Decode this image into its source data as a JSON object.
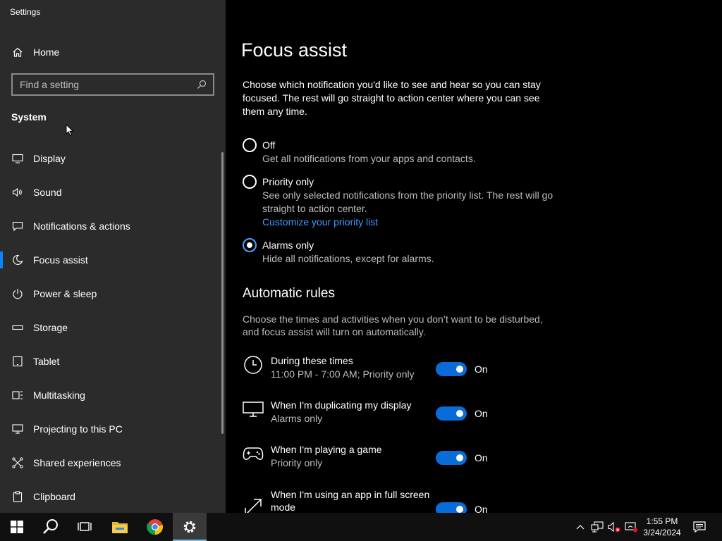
{
  "window": {
    "title": "Settings"
  },
  "sidebar": {
    "home_label": "Home",
    "search_placeholder": "Find a setting",
    "section": "System",
    "items": [
      {
        "label": "Display",
        "icon": "monitor-icon"
      },
      {
        "label": "Sound",
        "icon": "speaker-icon"
      },
      {
        "label": "Notifications & actions",
        "icon": "notification-icon"
      },
      {
        "label": "Focus assist",
        "icon": "moon-icon",
        "active": true
      },
      {
        "label": "Power & sleep",
        "icon": "power-icon"
      },
      {
        "label": "Storage",
        "icon": "storage-icon"
      },
      {
        "label": "Tablet",
        "icon": "tablet-icon"
      },
      {
        "label": "Multitasking",
        "icon": "multitasking-icon"
      },
      {
        "label": "Projecting to this PC",
        "icon": "projecting-icon"
      },
      {
        "label": "Shared experiences",
        "icon": "shared-icon"
      },
      {
        "label": "Clipboard",
        "icon": "clipboard-icon"
      }
    ]
  },
  "main": {
    "title": "Focus assist",
    "description": "Choose which notification you'd like to see and hear so you can stay focused. The rest will go straight to action center where you can see them any time.",
    "options": [
      {
        "title": "Off",
        "sub": "Get all notifications from your apps and contacts.",
        "checked": false
      },
      {
        "title": "Priority only",
        "sub": "See only selected notifications from the priority list. The rest will go straight to action center.",
        "link": "Customize your priority list",
        "checked": false
      },
      {
        "title": "Alarms only",
        "sub": "Hide all notifications, except for alarms.",
        "checked": true
      }
    ],
    "rules_heading": "Automatic rules",
    "rules_description": "Choose the times and activities when you don’t want to be disturbed, and focus assist will turn on automatically.",
    "rules": [
      {
        "title": "During these times",
        "sub": "11:00 PM - 7:00 AM; Priority only",
        "state": "On",
        "icon": "clock-icon"
      },
      {
        "title": "When I'm duplicating my display",
        "sub": "Alarms only",
        "state": "On",
        "icon": "display-icon"
      },
      {
        "title": "When I'm playing a game",
        "sub": "Priority only",
        "state": "On",
        "icon": "gamepad-icon"
      },
      {
        "title": "When I'm using an app in full screen mode",
        "sub": "",
        "state": "On",
        "icon": "fullscreen-icon"
      }
    ]
  },
  "taskbar": {
    "time": "1:55 PM",
    "date": "3/24/2024"
  },
  "colors": {
    "accent": "#0a6cd9",
    "link": "#3d9bff",
    "sidebar_bg": "#2b2b2b"
  }
}
